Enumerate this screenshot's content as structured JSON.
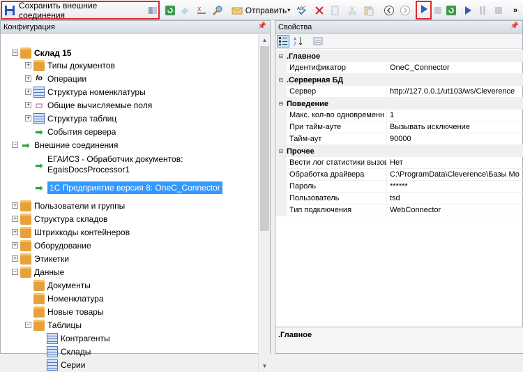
{
  "toolbar": {
    "save_label": "Сохранить внешние соединения",
    "send_label": "Отправить"
  },
  "config_panel": {
    "title": "Конфигурация",
    "nodes": [
      {
        "label": "Склад 15"
      },
      {
        "label": "Типы документов"
      },
      {
        "label": "Операции"
      },
      {
        "label": "Структура номенклатуры"
      },
      {
        "label": "Общие вычисляемые поля"
      },
      {
        "label": "Структура таблиц"
      },
      {
        "label": "События сервера"
      },
      {
        "label": "Внешние соединения"
      },
      {
        "label": "ЕГАИС3 - Обработчик документов:"
      },
      {
        "label": "EgaisDocsProcessor1"
      },
      {
        "label": "1С Предприятие версия 8: OneC_Connector"
      },
      {
        "label": "Пользователи и группы"
      },
      {
        "label": "Структура складов"
      },
      {
        "label": "Штрихкоды контейнеров"
      },
      {
        "label": "Оборудование"
      },
      {
        "label": "Этикетки"
      },
      {
        "label": "Данные"
      },
      {
        "label": "Документы"
      },
      {
        "label": "Номенклатура"
      },
      {
        "label": "Новые товары"
      },
      {
        "label": "Таблицы"
      },
      {
        "label": "Контрагенты"
      },
      {
        "label": "Склады"
      },
      {
        "label": "Серии"
      }
    ]
  },
  "props_panel": {
    "title": "Свойства",
    "categories": [
      {
        "name": ".Главное",
        "rows": [
          {
            "key": "Идентификатор",
            "value": "OneC_Connector"
          }
        ]
      },
      {
        "name": ".Серверная БД",
        "rows": [
          {
            "key": "Сервер",
            "value": "http://127.0.0.1/ut103/ws/Cleverence"
          }
        ]
      },
      {
        "name": "Поведение",
        "rows": [
          {
            "key": "Макс. кол-во одновременн",
            "value": "1"
          },
          {
            "key": "При тайм-ауте",
            "value": "Вызывать исключение"
          },
          {
            "key": "Тайм-аут",
            "value": "90000"
          }
        ]
      },
      {
        "name": "Прочее",
        "rows": [
          {
            "key": "Вести лог статистики вызов",
            "value": "Нет"
          },
          {
            "key": "Обработка драйвера",
            "value": "C:\\ProgramData\\Cleverence\\Базы Мо"
          },
          {
            "key": "Пароль",
            "value": "******"
          },
          {
            "key": "Пользователь",
            "value": "tsd"
          },
          {
            "key": "Тип подключения",
            "value": "WebConnector"
          }
        ]
      }
    ],
    "description_title": ".Главное"
  },
  "colors": {
    "selection": "#3399ff",
    "highlight": "#e3262a"
  }
}
